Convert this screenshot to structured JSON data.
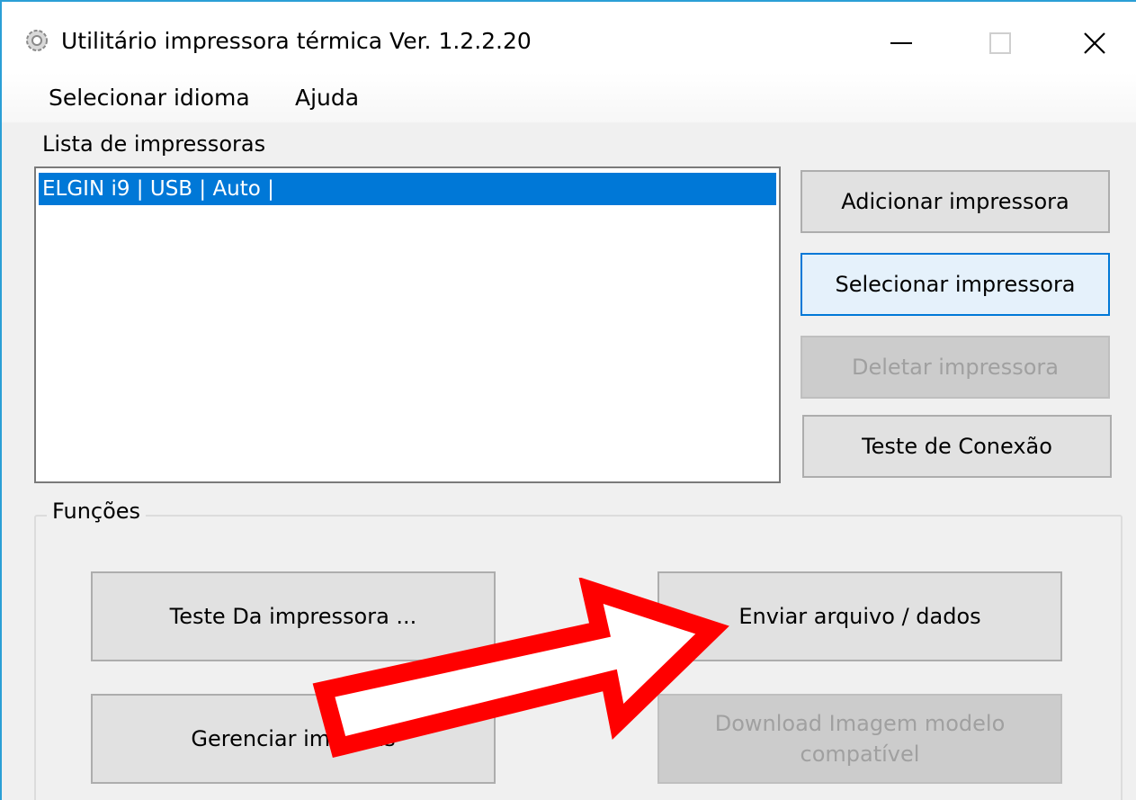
{
  "window": {
    "title": "Utilitário impressora térmica Ver. 1.2.2.20",
    "icon": "gear-icon",
    "controls": [
      "minimize-icon",
      "maximize-icon",
      "close-icon"
    ]
  },
  "menu": {
    "items": [
      "Selecionar idioma",
      "Ajuda"
    ]
  },
  "printers": {
    "label": "Lista de impressoras",
    "items": [
      "ELGIN i9 | USB | Auto |"
    ],
    "selected_index": 0
  },
  "printer_buttons": {
    "add": "Adicionar impressora",
    "select": "Selecionar impressora",
    "delete": "Deletar impressora",
    "test_connection": "Teste de Conexão"
  },
  "functions": {
    "label": "Funções",
    "test_printer": "Teste Da impressora ...",
    "send_file": "Enviar arquivo / dados",
    "manage": "Gerenciar imagens",
    "download_line1": "Download Imagem modelo",
    "download_line2": "compatível"
  },
  "annotation": {
    "type": "arrow",
    "color": "#ff0000",
    "points_to": "Enviar arquivo / dados"
  },
  "colors": {
    "selection": "#0078d7",
    "window_border": "#2b9fd6",
    "arrow": "#ff0000"
  }
}
